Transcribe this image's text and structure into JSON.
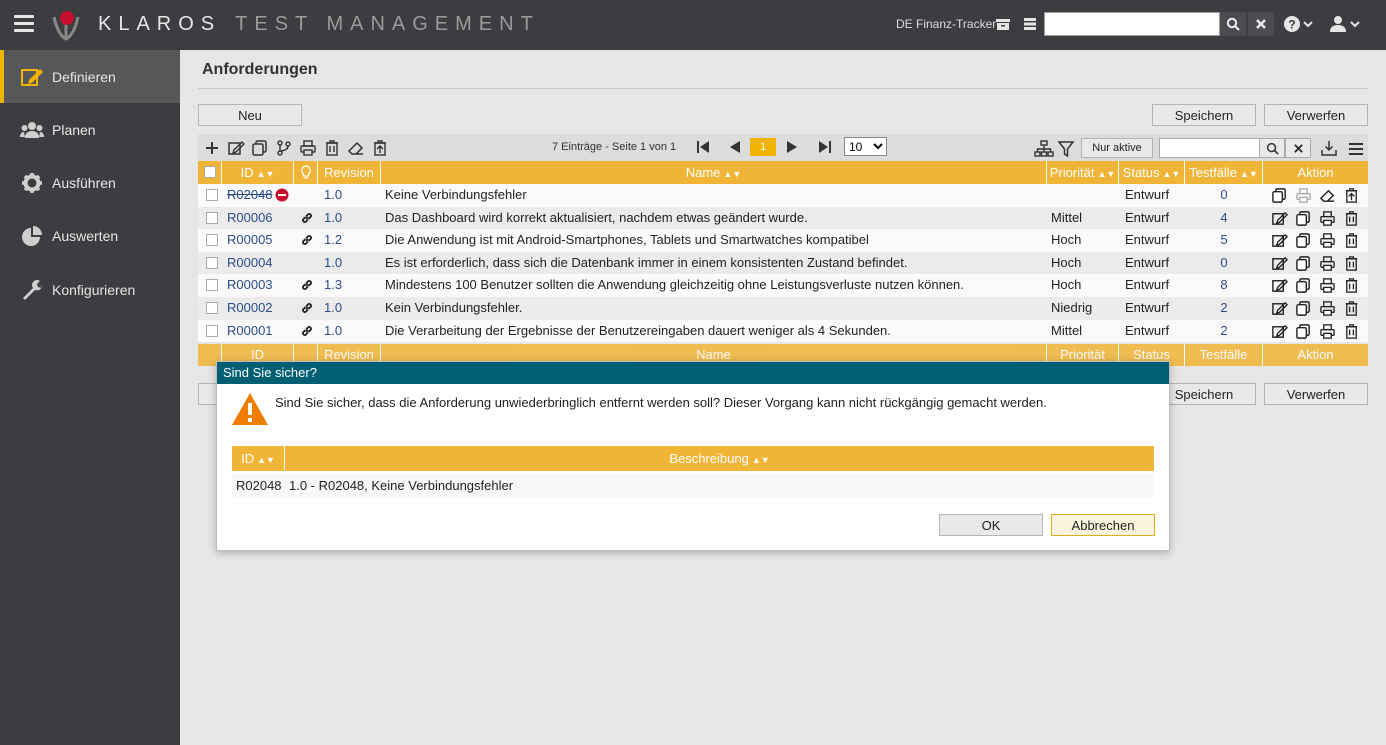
{
  "app": {
    "brand_bold": "KLAROS",
    "brand_light": "TEST MANAGEMENT",
    "project": "DE Finanz-Tracker",
    "accent": "#f0b300",
    "header_color": "#f0b536",
    "dialog_header_color": "#005f73"
  },
  "topbar": {
    "icons": [
      "menu-icon",
      "archive-icon",
      "server-icon",
      "search-icon",
      "close-icon",
      "help-icon",
      "user-icon"
    ]
  },
  "sidebar": {
    "items": [
      {
        "label": "Definieren",
        "icon": "edit-icon",
        "active": true
      },
      {
        "label": "Planen",
        "icon": "users-icon",
        "active": false
      },
      {
        "label": "Ausführen",
        "icon": "gear-icon",
        "active": false
      },
      {
        "label": "Auswerten",
        "icon": "pie-chart-icon",
        "active": false
      },
      {
        "label": "Konfigurieren",
        "icon": "wrench-icon",
        "active": false
      }
    ]
  },
  "main": {
    "title": "Anforderungen",
    "new_label": "Neu",
    "save_label": "Speichern",
    "discard_label": "Verwerfen",
    "pager_info": "7 Einträge - Seite 1 von 1",
    "current_page": "1",
    "page_size": "10",
    "only_active_label": "Nur aktive"
  },
  "table": {
    "columns": [
      "ID",
      "Revision",
      "Name",
      "Priorität",
      "Status",
      "Testfälle",
      "Aktion"
    ],
    "rows": [
      {
        "id": "R02048",
        "revision": "1.0",
        "name": "Keine Verbindungsfehler",
        "priority": "",
        "status": "Entwurf",
        "testcases": "0",
        "linked": false,
        "deleted": true
      },
      {
        "id": "R00006",
        "revision": "1.0",
        "name": "Das Dashboard wird korrekt aktualisiert, nachdem etwas geändert wurde.",
        "priority": "Mittel",
        "status": "Entwurf",
        "testcases": "4",
        "linked": true,
        "deleted": false
      },
      {
        "id": "R00005",
        "revision": "1.2",
        "name": "Die Anwendung ist mit Android-Smartphones, Tablets und Smartwatches kompatibel",
        "priority": "Hoch",
        "status": "Entwurf",
        "testcases": "5",
        "linked": true,
        "deleted": false
      },
      {
        "id": "R00004",
        "revision": "1.0",
        "name": "Es ist erforderlich, dass sich die Datenbank immer in einem konsistenten Zustand befindet.",
        "priority": "Hoch",
        "status": "Entwurf",
        "testcases": "0",
        "linked": false,
        "deleted": false
      },
      {
        "id": "R00003",
        "revision": "1.3",
        "name": "Mindestens 100 Benutzer sollten die Anwendung gleichzeitig ohne Leistungsverluste nutzen können.",
        "priority": "Hoch",
        "status": "Entwurf",
        "testcases": "8",
        "linked": true,
        "deleted": false
      },
      {
        "id": "R00002",
        "revision": "1.0",
        "name": "Kein Verbindungsfehler.",
        "priority": "Niedrig",
        "status": "Entwurf",
        "testcases": "2",
        "linked": true,
        "deleted": false
      },
      {
        "id": "R00001",
        "revision": "1.0",
        "name": "Die Verarbeitung der Ergebnisse der Benutzereingaben dauert weniger als 4 Sekunden.",
        "priority": "Mittel",
        "status": "Entwurf",
        "testcases": "2",
        "linked": true,
        "deleted": false
      }
    ]
  },
  "dialog": {
    "title": "Sind Sie sicher?",
    "message": "Sind Sie sicher, dass die Anforderung unwiederbringlich entfernt werden soll? Dieser Vorgang kann nicht rückgängig gemacht werden.",
    "columns": [
      "ID",
      "Beschreibung"
    ],
    "row": {
      "id": "R02048",
      "description": "1.0 - R02048, Keine Verbindungsfehler"
    },
    "ok_label": "OK",
    "cancel_label": "Abbrechen"
  }
}
